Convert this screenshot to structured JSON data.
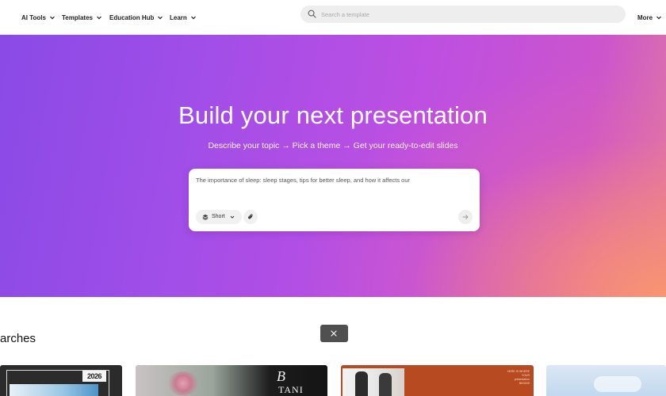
{
  "nav": {
    "items": [
      {
        "label": "AI Tools"
      },
      {
        "label": "Templates"
      },
      {
        "label": "Education Hub"
      },
      {
        "label": "Learn"
      }
    ],
    "more_label": "More",
    "search": {
      "placeholder": "Search a template",
      "value": ""
    }
  },
  "hero": {
    "title": "Build your next presentation",
    "subtitle": "Describe your topic → Pick a theme → Get your ready-to-edit slides",
    "prompt": {
      "value": "The importance of sleep: sleep stages, tips for better sleep, and how it affects our",
      "length_label": "Short"
    }
  },
  "section": {
    "title": "arches"
  },
  "thumbnails": {
    "t1": {
      "year": "2026"
    },
    "t2": {
      "monogram": "B",
      "name": "TANI"
    },
    "t3": {
      "tag": "HERE IS WHERE YOUR presentation BEGINS"
    }
  },
  "colors": {
    "hero_gradient_start": "#8a4ae6",
    "hero_gradient_mid": "#bd4fe2",
    "hero_gradient_end": "#f9966e",
    "search_bg": "#eeeeee",
    "toast_bg": "#505050"
  },
  "icons": {
    "nav_chevron": "chevron-down-icon",
    "search": "search-icon",
    "length": "layers-icon",
    "attach": "paperclip-icon",
    "send": "arrow-right-icon",
    "close": "close-icon"
  }
}
